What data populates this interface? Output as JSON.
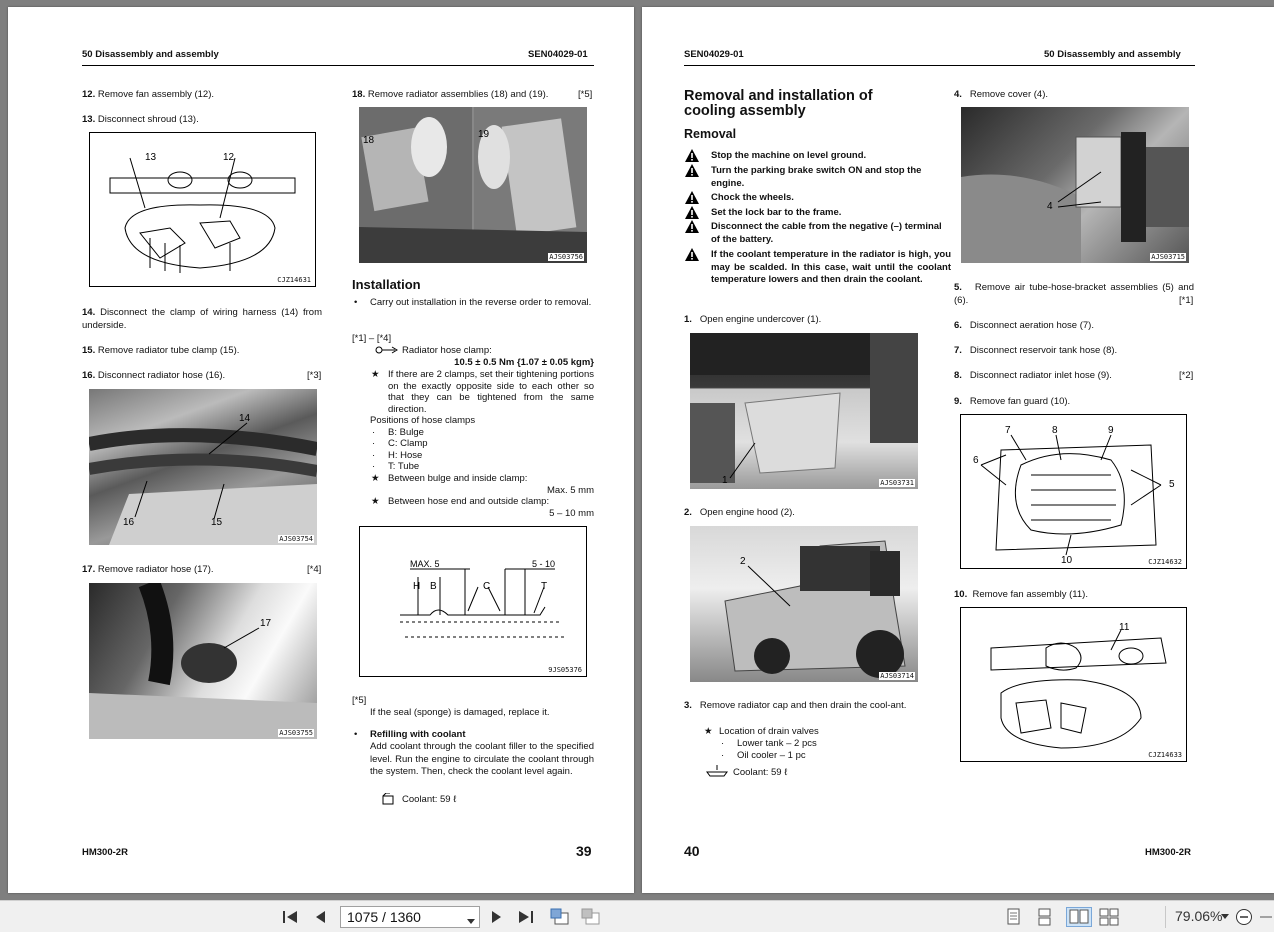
{
  "left_page": {
    "header_left": "50 Disassembly and assembly",
    "header_right": "SEN04029-01",
    "footer_left": "HM300-2R",
    "page_number": "39",
    "steps": [
      {
        "num": "12.",
        "text": "Remove fan assembly (12)."
      },
      {
        "num": "13.",
        "text": "Disconnect shroud (13)."
      },
      {
        "num": "14.",
        "text": "Disconnect the clamp of wiring harness (14) from underside."
      },
      {
        "num": "15.",
        "text": "Remove radiator tube clamp (15)."
      },
      {
        "num": "16.",
        "text": "Disconnect radiator hose (16).",
        "ref": "[*3]"
      },
      {
        "num": "17.",
        "text": "Remove radiator hose (17).",
        "ref": "[*4]"
      },
      {
        "num": "18.",
        "text": "Remove radiator assemblies (18) and (19).",
        "ref": "[*5]"
      }
    ],
    "figures": {
      "fig13_code": "CJZ14631",
      "fig13_labels": [
        "13",
        "12"
      ],
      "fig16_code": "AJS03754",
      "fig16_labels": [
        "14",
        "16",
        "15"
      ],
      "fig17_code": "AJS03755",
      "fig17_labels": [
        "17"
      ],
      "fig18_code": "AJS03756",
      "fig18_labels": [
        "18",
        "19"
      ],
      "clamp_code": "9JS05376",
      "clamp_labels": [
        "MAX. 5",
        "5 - 10",
        "H",
        "B",
        "C",
        "T"
      ]
    },
    "installation": {
      "heading": "Installation",
      "bullet": "Carry out installation in the reverse order to removal.",
      "ref1": "[*1] – [*4]",
      "clamp_label": "Radiator hose clamp:",
      "clamp_torque": "10.5 ± 0.5 Nm {1.07 ± 0.05 kgm}",
      "note1": "If there are 2 clamps, set their tightening portions on the exactly opposite side to each other so that they can be tightened from the same direction.",
      "positions_title": "Positions of hose clamps",
      "positions": [
        "B: Bulge",
        "C: Clamp",
        "H: Hose",
        "T: Tube"
      ],
      "note2": "Between bulge and inside clamp:",
      "note2_val": "Max. 5 mm",
      "note3": "Between hose end and outside clamp:",
      "note3_val": "5 – 10 mm",
      "ref5": "[*5]",
      "seal_text": "If the seal (sponge) is damaged, replace it.",
      "refill_title": "Refilling with coolant",
      "refill_text": "Add coolant through the coolant filler to the specified level.  Run the engine to circulate the coolant through the system.  Then, check the coolant level again.",
      "coolant": "Coolant: 59 ℓ"
    }
  },
  "right_page": {
    "header_left": "SEN04029-01",
    "header_right": "50 Disassembly and assembly",
    "footer_right": "HM300-2R",
    "page_number": "40",
    "title_line1": "Removal and installation of",
    "title_line2": "cooling assembly",
    "removal": "Removal",
    "warnings": [
      "Stop the machine on level ground.",
      "Turn the parking brake switch ON and stop the engine.",
      "Chock the wheels.",
      "Set the lock bar to the frame.",
      "Disconnect the cable from the negative (–) terminal of the battery.",
      "If the coolant temperature in the radiator is high, you may be scalded.  In this case, wait until the coolant temperature lowers and then drain the coolant."
    ],
    "steps": [
      {
        "num": "1.",
        "text": "Open engine undercover (1)."
      },
      {
        "num": "2.",
        "text": "Open engine hood (2)."
      },
      {
        "num": "3.",
        "text": "Remove radiator cap and then drain the cool-ant."
      },
      {
        "num": "4.",
        "text": "Remove cover (4)."
      },
      {
        "num": "5.",
        "text": "Remove air tube-hose-bracket assemblies (5) and (6).",
        "ref": "[*1]"
      },
      {
        "num": "6.",
        "text": "Disconnect aeration hose (7)."
      },
      {
        "num": "7.",
        "text": "Disconnect reservoir tank hose (8)."
      },
      {
        "num": "8.",
        "text": "Disconnect radiator inlet hose (9).",
        "ref": "[*2]"
      },
      {
        "num": "9.",
        "text": "Remove fan guard (10)."
      },
      {
        "num": "10.",
        "text": "Remove fan assembly (11)."
      }
    ],
    "drain": {
      "title": "Location of drain valves",
      "items": [
        "Lower tank – 2 pcs",
        "Oil cooler – 1 pc"
      ],
      "coolant": "Coolant: 59 ℓ"
    },
    "figures": {
      "fig1_code": "AJS03731",
      "fig1_labels": [
        "1"
      ],
      "fig2_code": "AJS03714",
      "fig2_labels": [
        "2"
      ],
      "fig4_code": "AJS03715",
      "fig4_labels": [
        "4"
      ],
      "fig9_code": "CJZ14632",
      "fig9_labels": [
        "7",
        "8",
        "9",
        "6",
        "5",
        "10"
      ],
      "fig10_code": "CJZ14633",
      "fig10_labels": [
        "11"
      ]
    }
  },
  "toolbar": {
    "page_value": "1075 / 1360",
    "zoom": "79.06%"
  }
}
